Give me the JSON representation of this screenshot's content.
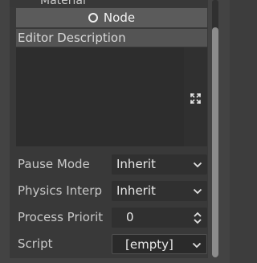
{
  "section_above": {
    "label": "Material"
  },
  "category": {
    "label": "Node"
  },
  "editor_description": {
    "label": "Editor Description",
    "value": ""
  },
  "properties": [
    {
      "label": "Pause Mode",
      "value": "Inherit",
      "control": "dropdown"
    },
    {
      "label": "Physics Interp",
      "value": "Inherit",
      "control": "dropdown"
    },
    {
      "label": "Process Priorit",
      "value": "0",
      "control": "spinbox"
    },
    {
      "label": "Script",
      "value": "[empty]",
      "control": "resource"
    }
  ],
  "icons": {
    "category": "circle-icon",
    "expand": "expand-icon",
    "dropdown": "chevron-down-icon",
    "spin": "spin-arrows-icon"
  },
  "colors": {
    "background": "#393939",
    "category_bg": "#5b5b5b",
    "field_bg": "#303030",
    "text": "#e6e6e6"
  }
}
